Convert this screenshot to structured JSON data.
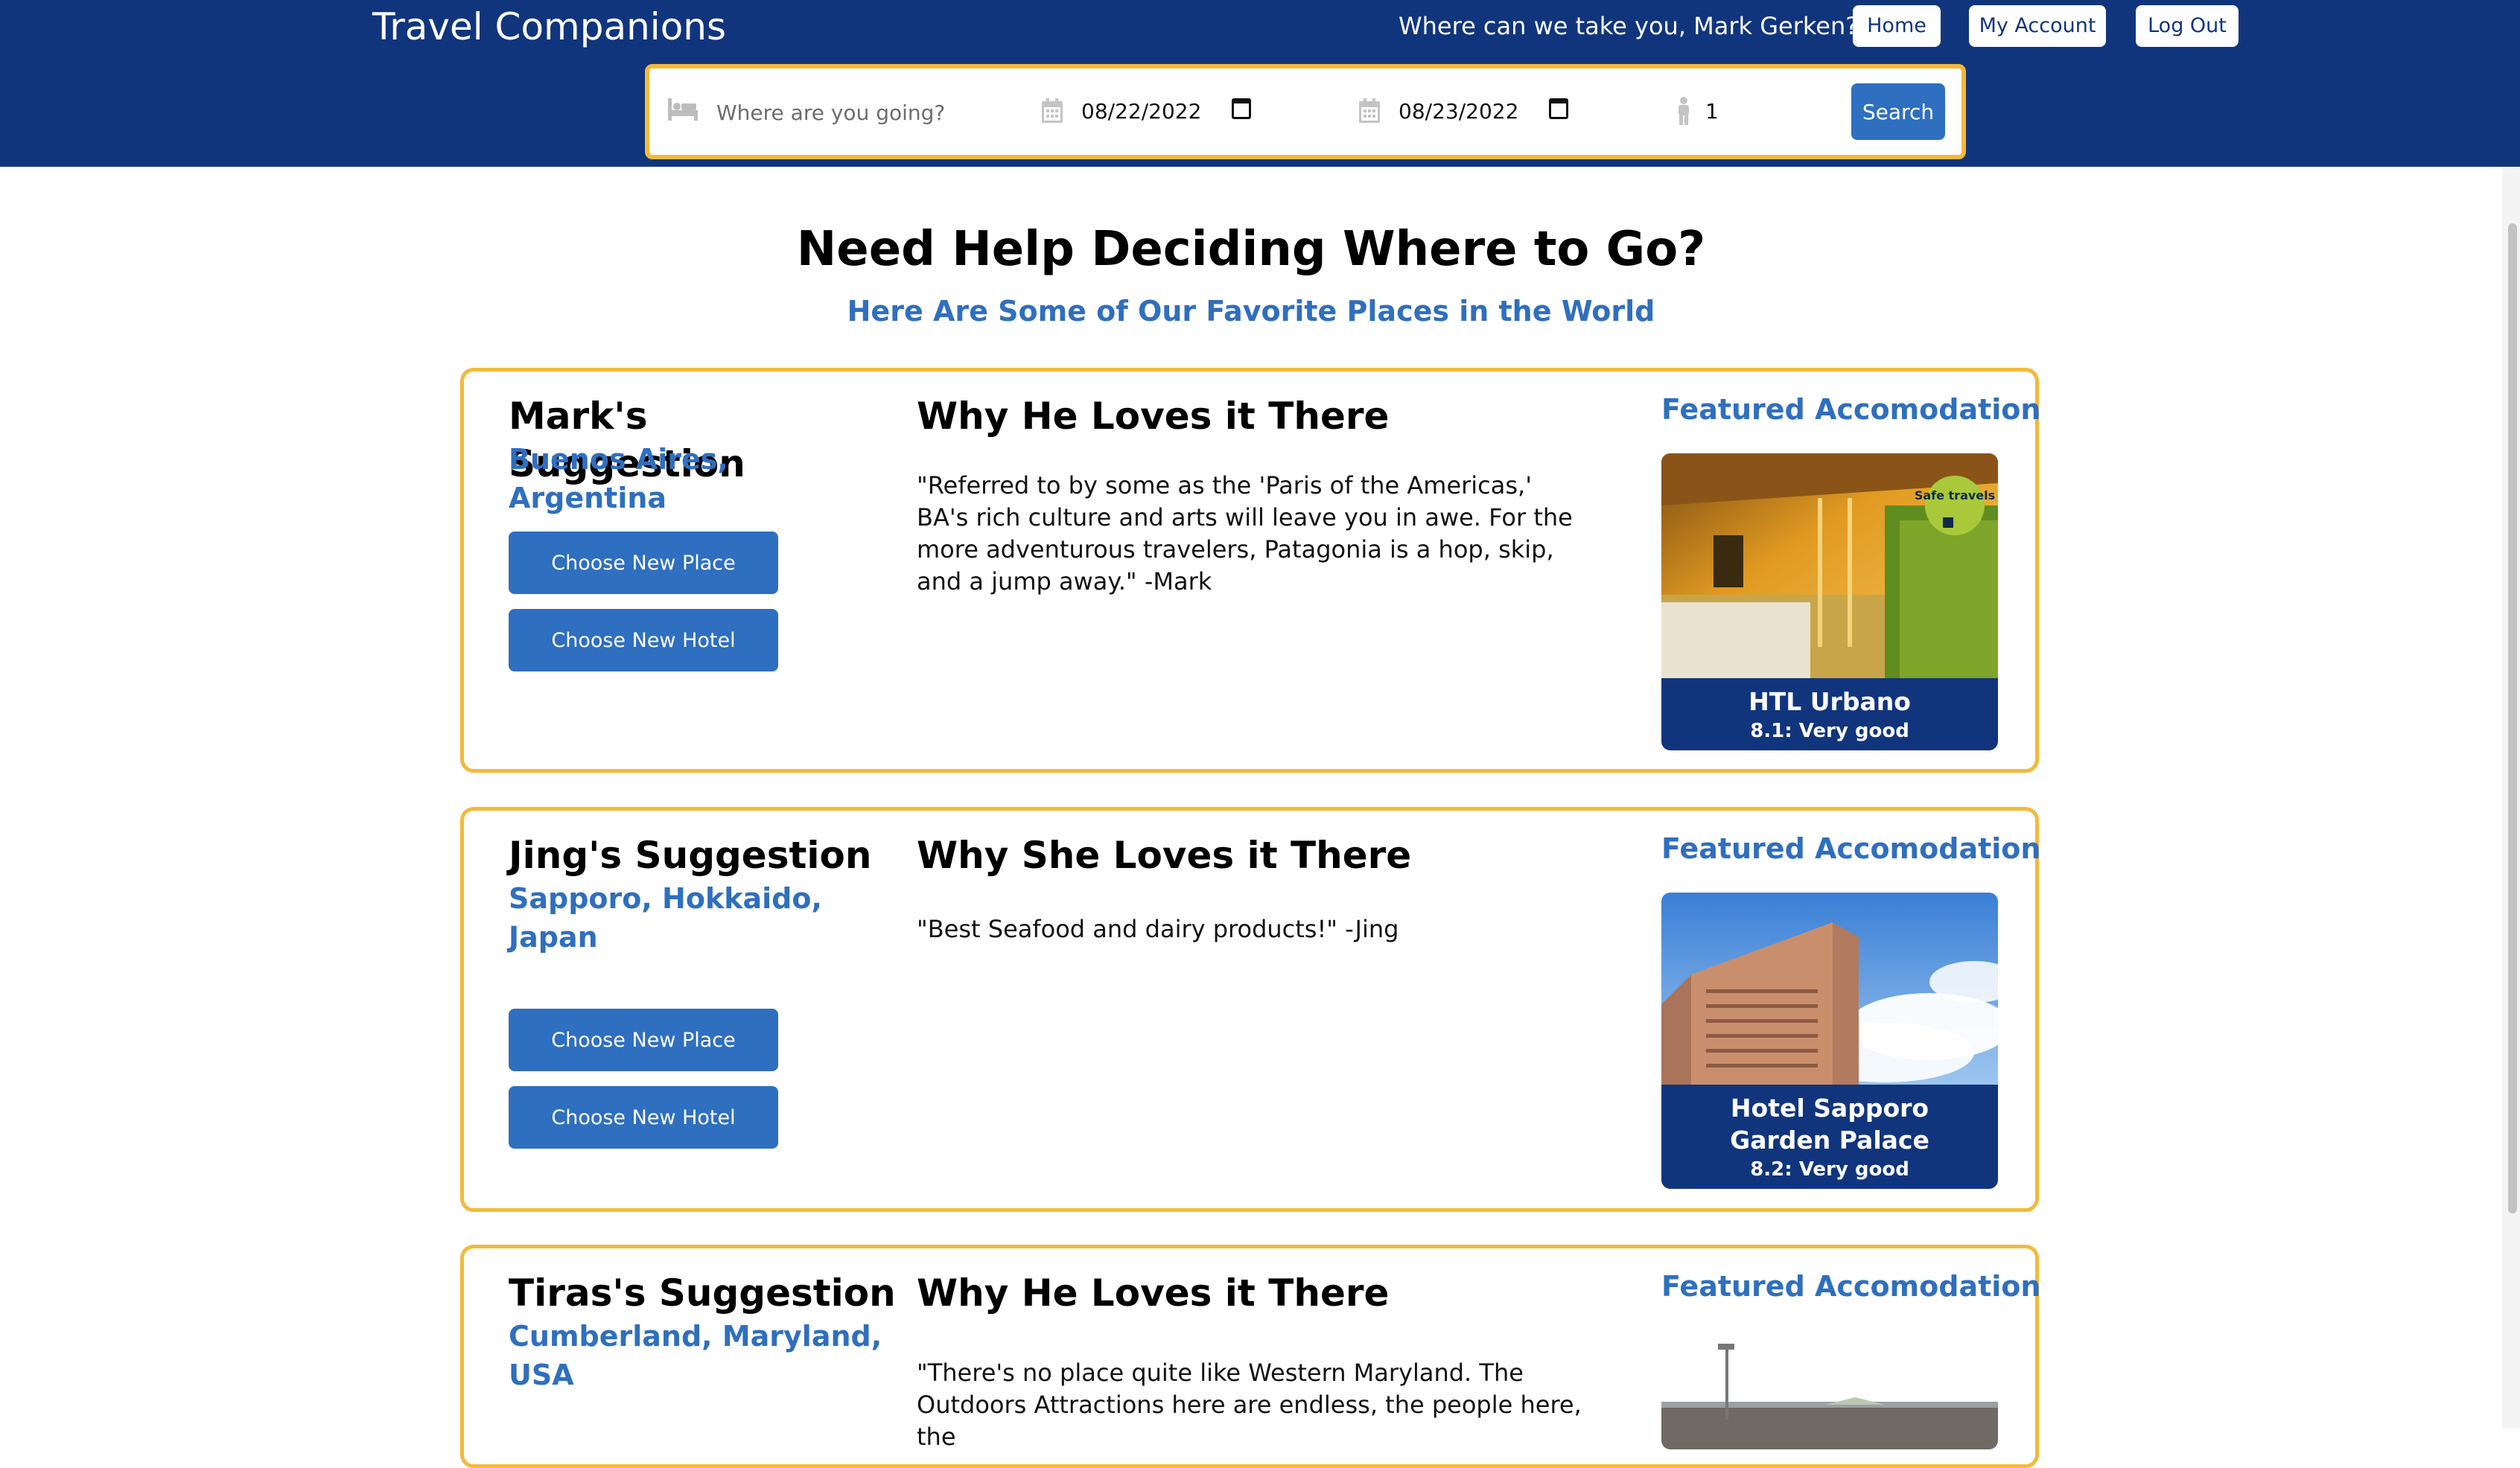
{
  "header": {
    "brand": "Travel Companions",
    "greeting": "Where can we take you, Mark Gerken?",
    "nav": {
      "home": "Home",
      "account": "My Account",
      "logout": "Log Out"
    }
  },
  "search": {
    "destination_placeholder": "Where are you going?",
    "checkin": "08/22/2022",
    "checkout": "08/23/2022",
    "guests": "1",
    "button": "Search"
  },
  "main": {
    "title": "Need Help Deciding Where to Go?",
    "subtitle": "Here Are Some of Our Favorite Places in the World"
  },
  "cards": [
    {
      "suggester": "Mark's Suggestion",
      "location": "Buenos Aires, Argentina",
      "choose_place": "Choose New Place",
      "choose_hotel": "Choose New Hotel",
      "why": "Why He Loves it There",
      "quote": "\"Referred to by some as the 'Paris of the Americas,' BA's rich culture and arts will leave you in awe. For the more adventurous travelers, Patagonia is a hop, skip, and a jump away.\" -Mark",
      "featured": "Featured Accomodation",
      "hotel_name": "HTL Urbano",
      "hotel_rating": "8.1: Very good",
      "badge_text": "Safe travels"
    },
    {
      "suggester": "Jing's Suggestion",
      "location": "Sapporo, Hokkaido, Japan",
      "choose_place": "Choose New Place",
      "choose_hotel": "Choose New Hotel",
      "why": "Why She Loves it There",
      "quote": "\"Best Seafood and dairy products!\" -Jing",
      "featured": "Featured Accomodation",
      "hotel_name": "Hotel Sapporo Garden Palace",
      "hotel_rating": "8.2: Very good"
    },
    {
      "suggester": "Tiras's Suggestion",
      "location": "Cumberland, Maryland, USA",
      "why": "Why He Loves it There",
      "quote": "\"There's no place quite like Western Maryland. The Outdoors Attractions here are endless, the people here, the",
      "featured": "Featured Accomodation"
    }
  ],
  "colors": {
    "navy": "#11357d",
    "accent_blue": "#2f6fbf",
    "card_border": "#f4b93a"
  },
  "icons": [
    "bed-icon",
    "calendar-icon",
    "person-icon"
  ]
}
